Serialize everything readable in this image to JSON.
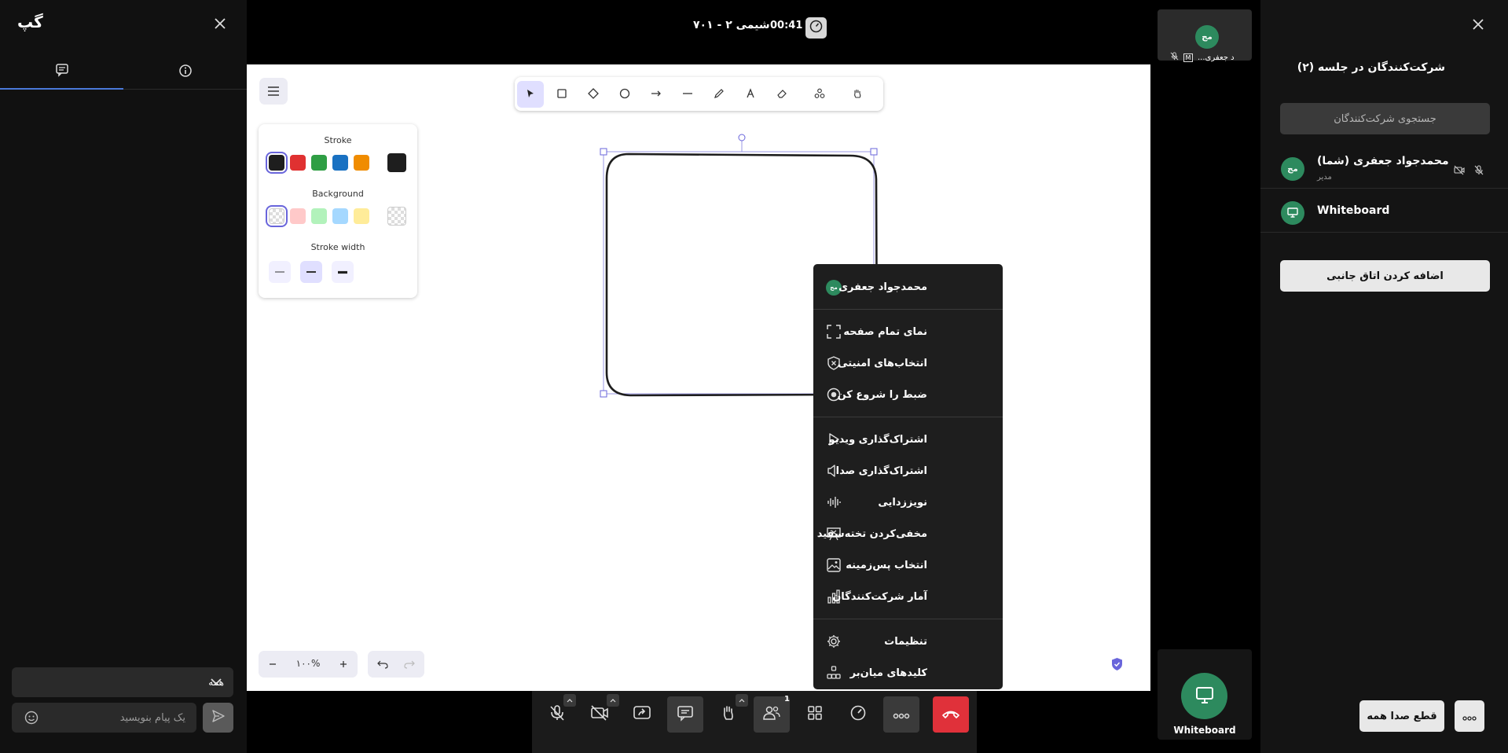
{
  "chat_panel": {
    "title": "گپ",
    "recipient": "همه",
    "input_placeholder": "یک پیام بنویسید"
  },
  "top_bar": {
    "session_title": "شیمی ۲ - ۷۰۱",
    "timer": "00:41"
  },
  "whiteboard": {
    "props": {
      "stroke_label": "Stroke",
      "background_label": "Background",
      "width_label": "Stroke width",
      "stroke_colors": [
        "#1e1e1e",
        "#e03131",
        "#2f9e44",
        "#1971c2",
        "#f08c00"
      ],
      "background_colors": [
        "transparent",
        "#ffc9c9",
        "#b2f2bb",
        "#a5d8ff",
        "#ffec99"
      ]
    },
    "zoom": "۱۰۰%"
  },
  "context_menu": {
    "user_name": "محمدجواد جعفری",
    "user_initials": "مج",
    "items": [
      {
        "label": "نمای تمام صفحه",
        "icon": "fullscreen-icon"
      },
      {
        "label": "انتخاب‌های امنیتی",
        "icon": "shield-x-icon"
      },
      {
        "label": "ضبط را شروع کن",
        "icon": "record-icon"
      },
      {
        "label": "اشتراک‌گذاری ویدیو",
        "icon": "play-icon"
      },
      {
        "label": "اشتراک‌گذاری صدا",
        "icon": "speaker-icon"
      },
      {
        "label": "نویززدایی",
        "icon": "noise-icon"
      },
      {
        "label": "مخفی‌کردن تخته‌سفید",
        "icon": "hide-whiteboard-icon"
      },
      {
        "label": "انتخاب پس‌زمینه",
        "icon": "image-icon"
      },
      {
        "label": "آمار شرکت‌کنندگان",
        "icon": "bar-chart-icon"
      },
      {
        "label": "تنظیمات",
        "icon": "gear-icon"
      },
      {
        "label": "کلیدهای میان‌بر",
        "icon": "shortcuts-icon"
      }
    ]
  },
  "video_tile": {
    "initials": "مج",
    "name": "...د جعفری",
    "badge": "M"
  },
  "whiteboard_tile": {
    "caption": "Whiteboard"
  },
  "participants_panel": {
    "title": "شرکت‌کنندگان در جلسه (۲)",
    "search_placeholder": "جستجوی شرکت‌کنندگان",
    "participants": [
      {
        "name": "محمدجواد جعفری (شما)",
        "role": "مدیر",
        "initials": "مج"
      },
      {
        "name": "Whiteboard",
        "role": ""
      }
    ],
    "add_breakout_label": "اضافه کردن اتاق جانبی",
    "mute_all_label": "قطع صدا همه"
  },
  "control_bar": {
    "participants_count": "1"
  },
  "colors": {
    "accent_green": "#2d8a5e",
    "hangup_red": "#e0313a",
    "selection": "#6965db"
  }
}
